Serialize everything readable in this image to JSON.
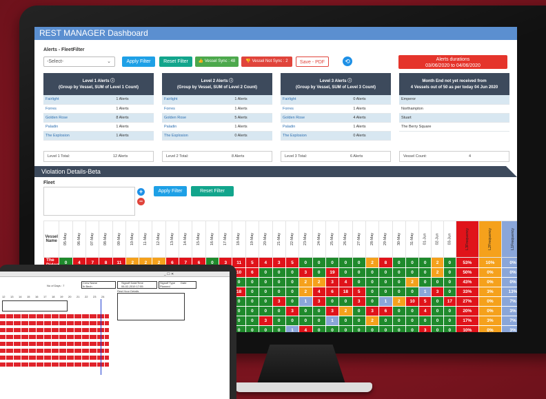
{
  "app": {
    "title": "REST MANAGER Dashboard"
  },
  "filters": {
    "label": "Alerts - FleetFilter",
    "select_value": "-Select-",
    "apply": "Apply Filter",
    "reset": "Reset Filter",
    "vessel_sync": "Vessel Sync : 48",
    "vessel_not_sync": "Vessel Not Sync : 2",
    "save_pdf": "Save - PDF"
  },
  "alerts_durations": {
    "title": "Alerts durations",
    "range": "03/06/2020 to 04/06/2020"
  },
  "panels": [
    {
      "title": "Level 1 Alerts",
      "subtitle": "(Group by Vessel, SUM of Level 1 Count)",
      "rows": [
        [
          "Fairlight",
          "1 Alerts"
        ],
        [
          "Forres",
          "1 Alerts"
        ],
        [
          "Golden Rose",
          "8 Alerts"
        ],
        [
          "Paladin",
          "1 Alerts"
        ],
        [
          "The Explosion",
          "1 Alerts"
        ]
      ],
      "total_label": "Level 1 Total:",
      "total_value": "12 Alerts"
    },
    {
      "title": "Level 2 Alerts",
      "subtitle": "(Group by Vessel, SUM of Level 2 Count)",
      "rows": [
        [
          "Fairlight",
          "1 Alerts"
        ],
        [
          "Forres",
          "1 Alerts"
        ],
        [
          "Golden Rose",
          "5 Alerts"
        ],
        [
          "Paladin",
          "1 Alerts"
        ],
        [
          "The Explosion",
          "0 Alerts"
        ]
      ],
      "total_label": "Level 2 Total:",
      "total_value": "8 Alerts"
    },
    {
      "title": "Level 3 Alerts",
      "subtitle": "(Group by Vessel, SUM of Level 3 Count)",
      "rows": [
        [
          "Fairlight",
          "0 Alerts"
        ],
        [
          "Forres",
          "1 Alerts"
        ],
        [
          "Golden Rose",
          "4 Alerts"
        ],
        [
          "Paladin",
          "1 Alerts"
        ],
        [
          "The Explosion",
          "0 Alerts"
        ]
      ],
      "total_label": "Level 3 Total:",
      "total_value": "6 Alerts"
    },
    {
      "title": "Month End not yet received from",
      "subtitle": "4 Vessels out of 50 as per today 04 Jun 2020",
      "rows": [
        [
          "Emperor",
          ""
        ],
        [
          "Northampton",
          ""
        ],
        [
          "Stuart",
          ""
        ],
        [
          "The Berry Square",
          ""
        ]
      ],
      "total_label": "Vessel Count:",
      "total_value": "4"
    }
  ],
  "violation": {
    "title": "Violation Details-Beta",
    "fleet_label": "Fleet",
    "apply": "Apply Filter",
    "reset": "Reset Filter",
    "vessel_col": "Vessel Name",
    "dates": [
      "05-May",
      "06-May",
      "07-May",
      "08-May",
      "09-May",
      "10-May",
      "11-May",
      "12-May",
      "13-May",
      "14-May",
      "15-May",
      "16-May",
      "17-May",
      "18-May",
      "19-May",
      "20-May",
      "21-May",
      "22-May",
      "23-May",
      "24-May",
      "25-May",
      "26-May",
      "27-May",
      "28-May",
      "29-May",
      "30-May",
      "31-May",
      "01-Jun",
      "02-Jun",
      "03-Jun"
    ],
    "pct_cols": [
      "L3Frequency",
      "L2Frequency",
      "L1Frequency",
      "No Violation"
    ],
    "first_row_name": "The Didon",
    "rows": [
      {
        "v": [
          "0",
          "4",
          "7",
          "8",
          "11",
          "2",
          "2",
          "2",
          "6",
          "7",
          "6",
          "0",
          "3",
          "11",
          "5",
          "4",
          "3",
          "5",
          "0",
          "0",
          "0",
          "0",
          "0",
          "2",
          "8",
          "0",
          "0",
          "0",
          "2",
          "0"
        ],
        "p": [
          "53%",
          "10%",
          "0%",
          "37%"
        ]
      },
      {
        "v": [
          "",
          "",
          "",
          "",
          "",
          "",
          "",
          "",
          "",
          "",
          "",
          "3",
          "0",
          "10",
          "6",
          "0",
          "0",
          "0",
          "3",
          "0",
          "19",
          "0",
          "0",
          "0",
          "0",
          "0",
          "0",
          "0",
          "2",
          "0"
        ],
        "p": [
          "50%",
          "0%",
          "0%",
          "50%"
        ]
      },
      {
        "v": [
          "",
          "",
          "",
          "",
          "",
          "",
          "",
          "",
          "",
          "",
          "",
          "3",
          "0",
          "0",
          "0",
          "0",
          "0",
          "0",
          "2",
          "2",
          "3",
          "4",
          "0",
          "0",
          "0",
          "0",
          "2",
          "0",
          "0",
          "0"
        ],
        "p": [
          "43%",
          "0%",
          "0%",
          "57%"
        ]
      },
      {
        "v": [
          "",
          "",
          "",
          "",
          "",
          "",
          "",
          "",
          "",
          "",
          "",
          "3",
          "2",
          "18",
          "0",
          "0",
          "0",
          "0",
          "2",
          "4",
          "6",
          "18",
          "5",
          "0",
          "0",
          "0",
          "0",
          "1",
          "3",
          "0"
        ],
        "p": [
          "33%",
          "3%",
          "13%",
          "51%"
        ]
      },
      {
        "v": [
          "",
          "",
          "",
          "",
          "",
          "",
          "",
          "",
          "",
          "",
          "",
          "0",
          "0",
          "0",
          "0",
          "0",
          "3",
          "0",
          "1",
          "3",
          "0",
          "0",
          "3",
          "0",
          "1",
          "2",
          "10",
          "5",
          "0",
          "17"
        ],
        "p": [
          "27%",
          "0%",
          "7%",
          "66%"
        ]
      },
      {
        "v": [
          "",
          "",
          "",
          "",
          "",
          "",
          "",
          "",
          "",
          "",
          "",
          "0",
          "0",
          "0",
          "0",
          "0",
          "0",
          "3",
          "0",
          "0",
          "3",
          "2",
          "0",
          "3",
          "6",
          "0",
          "0",
          "4",
          "0",
          "0"
        ],
        "p": [
          "20%",
          "0%",
          "3%",
          "77%"
        ]
      },
      {
        "v": [
          "",
          "",
          "",
          "",
          "",
          "",
          "",
          "",
          "",
          "",
          "",
          "0",
          "3",
          "0",
          "0",
          "3",
          "0",
          "0",
          "0",
          "0",
          "1",
          "0",
          "0",
          "2",
          "0",
          "0",
          "0",
          "0",
          "0",
          "0"
        ],
        "p": [
          "17%",
          "3%",
          "7%",
          "73%"
        ]
      },
      {
        "v": [
          "",
          "",
          "",
          "",
          "",
          "",
          "",
          "",
          "",
          "",
          "",
          "0",
          "0",
          "0",
          "0",
          "0",
          "0",
          "1",
          "4",
          "0",
          "0",
          "0",
          "0",
          "0",
          "0",
          "0",
          "0",
          "3",
          "0",
          "0"
        ],
        "p": [
          "10%",
          "0%",
          "3%",
          "87%"
        ]
      }
    ],
    "colors": {
      "red": "#e0131a",
      "green": "#1f8a2c",
      "orange": "#f5a11c",
      "blue": "#8aa6d9",
      "yellow": "#ffd23a"
    }
  },
  "laptop": {
    "no_of_days": "No of Days : 7",
    "crew_name_label": "Crew Name",
    "crew_name_value": "Ib Bech",
    "signoff_label": "Signoff Date/Time",
    "signoff_value": "06-02-2019 17:55",
    "signoff_type_label": "Signoff Type",
    "signoff_type_value": "Planned",
    "date_label": "Date",
    "rest_details": "Rest Hour Details",
    "hours": [
      "12",
      "13",
      "14",
      "15",
      "16",
      "17",
      "18",
      "19",
      "20",
      "21",
      "22",
      "23",
      "24"
    ]
  }
}
